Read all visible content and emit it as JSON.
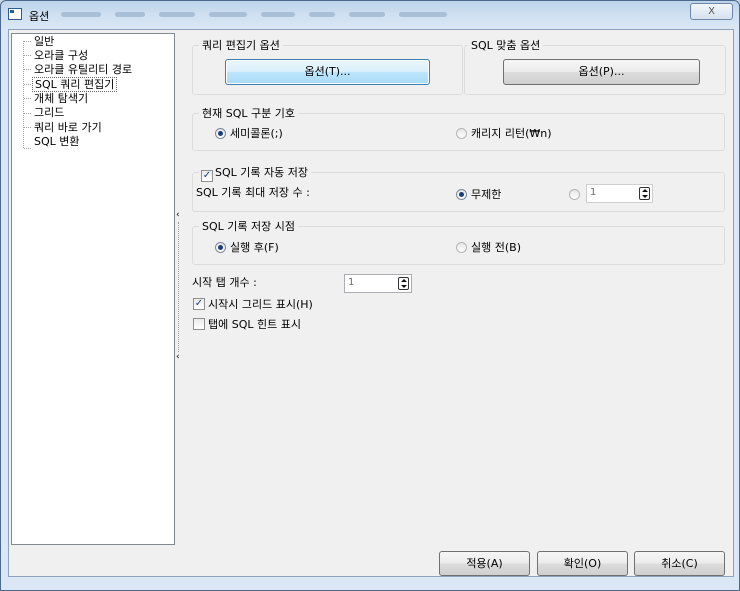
{
  "window": {
    "title": "옵션",
    "close_label": "X"
  },
  "tree": {
    "items": [
      {
        "label": "일반"
      },
      {
        "label": "오라클 구성"
      },
      {
        "label": "오라클 유틸리티 경로"
      },
      {
        "label": "SQL 쿼리 편집기",
        "selected": true
      },
      {
        "label": "개체 탐색기"
      },
      {
        "label": "그리드"
      },
      {
        "label": "쿼리 바로 가기"
      },
      {
        "label": "SQL 변환"
      }
    ]
  },
  "query_editor_options": {
    "group_label": "쿼리 편집기 옵션",
    "button_label": "옵션(T)..."
  },
  "sql_format_options": {
    "group_label": "SQL 맞춤 옵션",
    "button_label": "옵션(P)..."
  },
  "sql_delimiter": {
    "group_label": "현재 SQL 구분 기호",
    "options": [
      {
        "label": "세미콜론(;)",
        "selected": true
      },
      {
        "label": "캐리지 리턴(₩n)",
        "selected": false
      }
    ]
  },
  "sql_history": {
    "autosave_label": "SQL 기록 자동 저장",
    "autosave_checked": true,
    "max_count_label": "SQL 기록 최대 저장 수 :",
    "unlimited_label": "무제한",
    "unlimited_selected": true,
    "limit_value": "1"
  },
  "save_timing": {
    "group_label": "SQL 기록 저장 시점",
    "options": [
      {
        "label": "실행 후(F)",
        "selected": true
      },
      {
        "label": "실행 전(B)",
        "selected": false
      }
    ]
  },
  "startup": {
    "tab_count_label": "시작 탭 개수 :",
    "tab_count_value": "1",
    "show_grid_label": "시작시 그리드 표시(H)",
    "show_grid_checked": true,
    "show_hint_label": "탭에 SQL 힌트 표시",
    "show_hint_checked": false
  },
  "footer": {
    "apply_label": "적용(A)",
    "ok_label": "확인(O)",
    "cancel_label": "취소(C)"
  }
}
